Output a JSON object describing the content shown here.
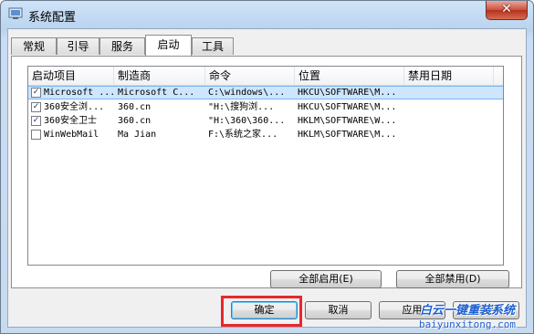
{
  "window": {
    "title": "系统配置",
    "close_glyph": "✕"
  },
  "tabs": [
    {
      "label": "常规",
      "active": false
    },
    {
      "label": "引导",
      "active": false
    },
    {
      "label": "服务",
      "active": false
    },
    {
      "label": "启动",
      "active": true
    },
    {
      "label": "工具",
      "active": false
    }
  ],
  "startup_table": {
    "columns": [
      "启动项目",
      "制造商",
      "命令",
      "位置",
      "禁用日期"
    ],
    "rows": [
      {
        "checked": true,
        "selected": true,
        "item": "Microsoft ...",
        "manufacturer": "Microsoft C...",
        "command": "C:\\windows\\...",
        "location": "HKCU\\SOFTWARE\\M...",
        "disabled_date": ""
      },
      {
        "checked": true,
        "selected": false,
        "item": "360安全浏...",
        "manufacturer": "360.cn",
        "command": "\"H:\\搜狗浏...",
        "location": "HKCU\\SOFTWARE\\M...",
        "disabled_date": ""
      },
      {
        "checked": true,
        "selected": false,
        "item": "360安全卫士",
        "manufacturer": "360.cn",
        "command": "\"H:\\360\\360...",
        "location": "HKLM\\SOFTWARE\\W...",
        "disabled_date": ""
      },
      {
        "checked": false,
        "selected": false,
        "item": "WinWebMail",
        "manufacturer": "Ma Jian",
        "command": "F:\\系统之家...",
        "location": "HKLM\\SOFTWARE\\M...",
        "disabled_date": ""
      }
    ]
  },
  "buttons": {
    "enable_all": "全部启用(E)",
    "disable_all": "全部禁用(D)",
    "ok": "确定",
    "cancel": "取消",
    "apply": "应用",
    "help": "帮助"
  },
  "watermark": {
    "title": "白云一键重装系统",
    "url": "baiyunxitong.com"
  },
  "colors": {
    "highlight_border": "#e8272b",
    "selection": "#cde5fd",
    "watermark": "#1d5fd0"
  }
}
